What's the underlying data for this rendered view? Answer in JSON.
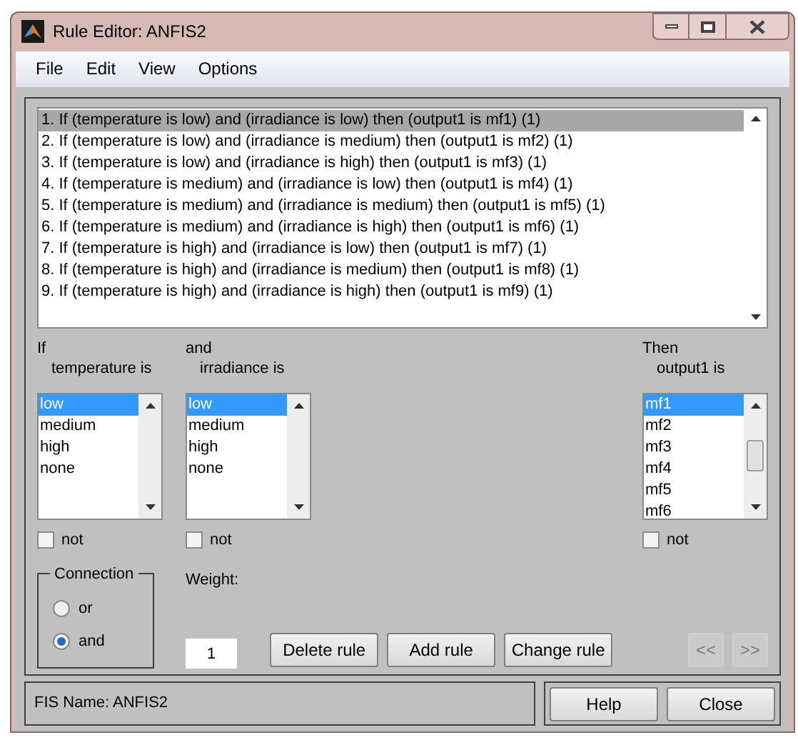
{
  "window": {
    "title": "Rule Editor: ANFIS2"
  },
  "menu": [
    "File",
    "Edit",
    "View",
    "Options"
  ],
  "rules": [
    {
      "text": "1. If (temperature is low) and (irradiance is low) then (output1 is mf1) (1)",
      "selected": true
    },
    {
      "text": "2. If (temperature is low) and (irradiance is medium) then (output1 is mf2) (1)",
      "selected": false
    },
    {
      "text": "3. If (temperature is low) and (irradiance is high) then (output1 is mf3) (1)",
      "selected": false
    },
    {
      "text": "4. If (temperature is medium) and (irradiance is low) then (output1 is mf4) (1)",
      "selected": false
    },
    {
      "text": "5. If (temperature is medium) and (irradiance is medium) then (output1 is mf5) (1)",
      "selected": false
    },
    {
      "text": "6. If (temperature is medium) and (irradiance is high) then (output1 is mf6) (1)",
      "selected": false
    },
    {
      "text": "7. If (temperature is high) and (irradiance is low) then (output1 is mf7) (1)",
      "selected": false
    },
    {
      "text": "8. If (temperature is high) and (irradiance is medium) then (output1 is mf8) (1)",
      "selected": false
    },
    {
      "text": "9. If (temperature is high) and (irradiance is high) then (output1 is mf9) (1)",
      "selected": false
    }
  ],
  "inputs": [
    {
      "header": "If",
      "label": "temperature is",
      "not_label": "not",
      "not_checked": false,
      "items": [
        {
          "label": "low",
          "selected": true
        },
        {
          "label": "medium",
          "selected": false
        },
        {
          "label": "high",
          "selected": false
        },
        {
          "label": "none",
          "selected": false
        }
      ]
    },
    {
      "header": "and",
      "label": "irradiance is",
      "not_label": "not",
      "not_checked": false,
      "items": [
        {
          "label": "low",
          "selected": true
        },
        {
          "label": "medium",
          "selected": false
        },
        {
          "label": "high",
          "selected": false
        },
        {
          "label": "none",
          "selected": false
        }
      ]
    }
  ],
  "output": {
    "header": "Then",
    "label": "output1 is",
    "not_label": "not",
    "not_checked": false,
    "items": [
      {
        "label": "mf1",
        "selected": true
      },
      {
        "label": "mf2",
        "selected": false
      },
      {
        "label": "mf3",
        "selected": false
      },
      {
        "label": "mf4",
        "selected": false
      },
      {
        "label": "mf5",
        "selected": false
      },
      {
        "label": "mf6",
        "selected": false
      }
    ]
  },
  "connection": {
    "title": "Connection",
    "options": [
      {
        "label": "or",
        "selected": false
      },
      {
        "label": "and",
        "selected": true
      }
    ]
  },
  "weight": {
    "label": "Weight:",
    "value": "1"
  },
  "rule_buttons": [
    {
      "label": "Delete rule",
      "disabled": false
    },
    {
      "label": "Add rule",
      "disabled": false
    },
    {
      "label": "Change rule",
      "disabled": false
    }
  ],
  "nav_buttons": [
    {
      "label": "<<",
      "disabled": true
    },
    {
      "label": ">>",
      "disabled": true
    }
  ],
  "status": "FIS Name: ANFIS2",
  "footer_buttons": [
    {
      "label": "Help",
      "disabled": false
    },
    {
      "label": "Close",
      "disabled": false
    }
  ]
}
